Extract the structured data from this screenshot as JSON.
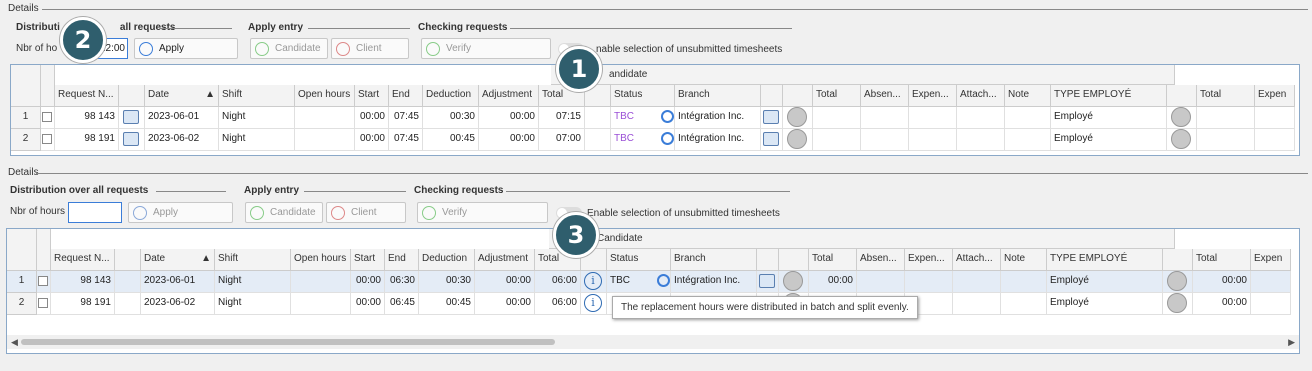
{
  "details_title": "Details",
  "groups": {
    "distribution": "Distribution over all requests",
    "apply_entry": "Apply entry",
    "checking": "Checking requests"
  },
  "nbr_hours_label": "Nbr of hours",
  "buttons": {
    "apply": "Apply",
    "candidate": "Candidate",
    "client": "Client",
    "verify": "Verify"
  },
  "toggle_label": "Enable selection of unsubmitted timesheets",
  "top_partial": {
    "distribution_label": "Distributi",
    "distribution_suffix": "all requests",
    "nbr_label": "Nbr of ho",
    "hours_value": "12:00",
    "toggle_label": "nable selection of unsubmitted timesheets",
    "candidate_band": "andidate"
  },
  "badges": [
    "1",
    "2",
    "3"
  ],
  "band_label": "Candidate",
  "columns": [
    "Request N...",
    "",
    "Date",
    "Shift",
    "Open hours",
    "Start",
    "End",
    "Deduction",
    "Adjustment",
    "Total",
    "",
    "Status",
    "Branch",
    "",
    "",
    "Total",
    "Absen...",
    "Expen...",
    "Attach...",
    "Note",
    "TYPE EMPLOYÉ",
    "",
    "Total",
    "Expen"
  ],
  "top_rows": [
    {
      "n": "1",
      "req": "98 143",
      "date": "2023-06-01",
      "shift": "Night",
      "start": "00:00",
      "end": "07:45",
      "ded": "00:30",
      "adj": "00:00",
      "total": "07:15",
      "status": "TBC",
      "branch": "Intégration Inc.",
      "type": "Employé"
    },
    {
      "n": "2",
      "req": "98 191",
      "date": "2023-06-02",
      "shift": "Night",
      "start": "00:00",
      "end": "07:45",
      "ded": "00:45",
      "adj": "00:00",
      "total": "07:00",
      "status": "TBC",
      "branch": "Intégration Inc.",
      "type": "Employé"
    }
  ],
  "bottom_rows": [
    {
      "n": "1",
      "req": "98 143",
      "date": "2023-06-01",
      "shift": "Night",
      "start": "00:00",
      "end": "06:30",
      "ded": "00:30",
      "adj": "00:00",
      "total": "06:00",
      "status": "TBC",
      "branch": "Intégration Inc.",
      "total2": "00:00",
      "type": "Employé",
      "total3": "00:00"
    },
    {
      "n": "2",
      "req": "98 191",
      "date": "2023-06-02",
      "shift": "Night",
      "start": "00:00",
      "end": "06:45",
      "ded": "00:45",
      "adj": "00:00",
      "total": "06:00",
      "status": "",
      "branch": "",
      "total2": "",
      "type": "Employé",
      "total3": "00:00"
    }
  ],
  "tooltip": "The replacement hours were distributed in batch and split evenly.",
  "colors": {
    "accent": "#3b7dd8",
    "badge": "#2f5e6d",
    "tbc": "#9a4fd6"
  }
}
